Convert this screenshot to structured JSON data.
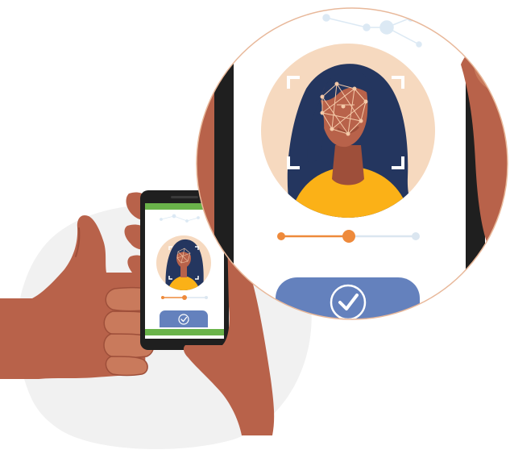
{
  "illustration": {
    "subject": "face-recognition-verification",
    "colors": {
      "skin": "#b8624a",
      "skin_dark": "#9e4f3a",
      "skin_light": "#c97a5c",
      "hair": "#24365f",
      "shirt": "#fbb117",
      "face_circle_bg": "#f6d9bf",
      "phone_body": "#1f1f1f",
      "screen_header": "#6ab34a",
      "confirm_button": "#6481bd",
      "slider_active": "#ee8a3b",
      "slider_inactive": "#dbe6f0",
      "background_blob": "#f1f1f1",
      "magnifier_border": "#e8b89a",
      "network_dots": "#dce9f4",
      "face_mesh": "#f4c9a8"
    },
    "icons": {
      "confirm": "check-icon",
      "scan": "face-scan-frame-icon",
      "mesh": "face-mesh-icon",
      "slider": "progress-slider"
    },
    "verification_progress": 0.5
  }
}
